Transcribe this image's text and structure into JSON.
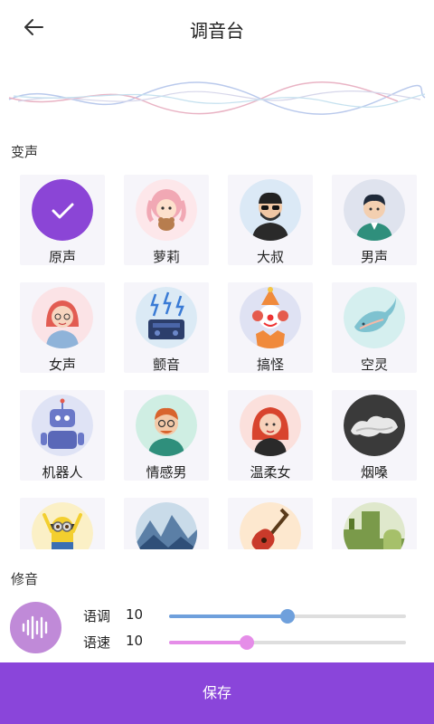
{
  "header": {
    "title": "调音台"
  },
  "sections": {
    "voice_change": "变声",
    "modify": "修音"
  },
  "voices": [
    {
      "label": "原声",
      "icon": "check-icon",
      "selected": true
    },
    {
      "label": "萝莉",
      "icon": "loli-avatar-icon"
    },
    {
      "label": "大叔",
      "icon": "uncle-avatar-icon"
    },
    {
      "label": "男声",
      "icon": "male-avatar-icon"
    },
    {
      "label": "女声",
      "icon": "female-avatar-icon"
    },
    {
      "label": "颤音",
      "icon": "tremolo-speaker-icon"
    },
    {
      "label": "搞怪",
      "icon": "clown-avatar-icon"
    },
    {
      "label": "空灵",
      "icon": "ethereal-whale-icon"
    },
    {
      "label": "机器人",
      "icon": "robot-avatar-icon"
    },
    {
      "label": "情感男",
      "icon": "emotional-man-avatar-icon"
    },
    {
      "label": "温柔女",
      "icon": "gentle-woman-avatar-icon"
    },
    {
      "label": "烟嗓",
      "icon": "smoky-voice-icon"
    },
    {
      "label": "",
      "icon": "minion-avatar-icon"
    },
    {
      "label": "",
      "icon": "mountain-avatar-icon"
    },
    {
      "label": "",
      "icon": "guitar-avatar-icon"
    },
    {
      "label": "",
      "icon": "green-scene-avatar-icon"
    }
  ],
  "modify": {
    "pitch": {
      "label": "语调",
      "value": "10",
      "level": 0.5
    },
    "speed": {
      "label": "语速",
      "value": "10",
      "level": 0.33
    }
  },
  "save_label": "保存",
  "colors": {
    "accent": "#8a45da",
    "selected_circle": "#8b45d6",
    "pitch_slider": "#6fa0dc",
    "speed_slider": "#e58de8",
    "modify_icon_bg": "#c08ad8"
  }
}
